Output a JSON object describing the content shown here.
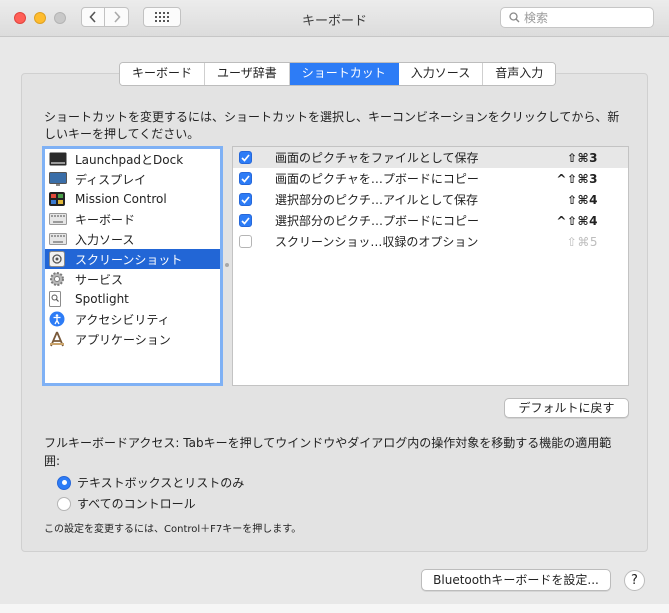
{
  "window": {
    "title": "キーボード",
    "search_placeholder": "検索"
  },
  "tabs": [
    {
      "label": "キーボード",
      "active": false
    },
    {
      "label": "ユーザ辞書",
      "active": false
    },
    {
      "label": "ショートカット",
      "active": true
    },
    {
      "label": "入力ソース",
      "active": false
    },
    {
      "label": "音声入力",
      "active": false
    }
  ],
  "description": "ショートカットを変更するには、ショートカットを選択し、キーコンビネーションをクリックしてから、新しいキーを押してください。",
  "categories": [
    {
      "label": "LaunchpadとDock",
      "icon": "launchpad-dock-icon"
    },
    {
      "label": "ディスプレイ",
      "icon": "display-icon"
    },
    {
      "label": "Mission Control",
      "icon": "mission-control-icon"
    },
    {
      "label": "キーボード",
      "icon": "keyboard-icon"
    },
    {
      "label": "入力ソース",
      "icon": "input-source-icon"
    },
    {
      "label": "スクリーンショット",
      "icon": "screenshot-icon",
      "selected": true
    },
    {
      "label": "サービス",
      "icon": "services-gear-icon"
    },
    {
      "label": "Spotlight",
      "icon": "spotlight-icon"
    },
    {
      "label": "アクセシビリティ",
      "icon": "accessibility-icon"
    },
    {
      "label": "アプリケーション",
      "icon": "applications-icon"
    }
  ],
  "shortcuts": [
    {
      "name": "画面のピクチャをファイルとして保存",
      "keys": "⇧⌘3",
      "checked": true
    },
    {
      "name": "画面のピクチャを…プボードにコピー",
      "keys": "^⇧⌘3",
      "checked": true
    },
    {
      "name": "選択部分のピクチ…アイルとして保存",
      "keys": "⇧⌘4",
      "checked": true
    },
    {
      "name": "選択部分のピクチ…プボードにコピー",
      "keys": "^⇧⌘4",
      "checked": true
    },
    {
      "name": "スクリーンショッ…収録のオプション",
      "keys": "⇧⌘5",
      "checked": false
    }
  ],
  "buttons": {
    "restore_defaults": "デフォルトに戻す",
    "bluetooth_keyboard": "Bluetoothキーボードを設定...",
    "help": "?"
  },
  "full_keyboard_access": {
    "label": "フルキーボードアクセス: Tabキーを押してウインドウやダイアログ内の操作対象を移動する機能の適用範囲:",
    "options": [
      {
        "label": "テキストボックスとリストのみ",
        "selected": true
      },
      {
        "label": "すべてのコントロール",
        "selected": false
      }
    ],
    "note": "この設定を変更するには、Control＋F7キーを押します。"
  },
  "colors": {
    "accent": "#2d7cf6",
    "selection": "#2266d6",
    "close": "#ff5f57",
    "minimize": "#febc2e"
  }
}
